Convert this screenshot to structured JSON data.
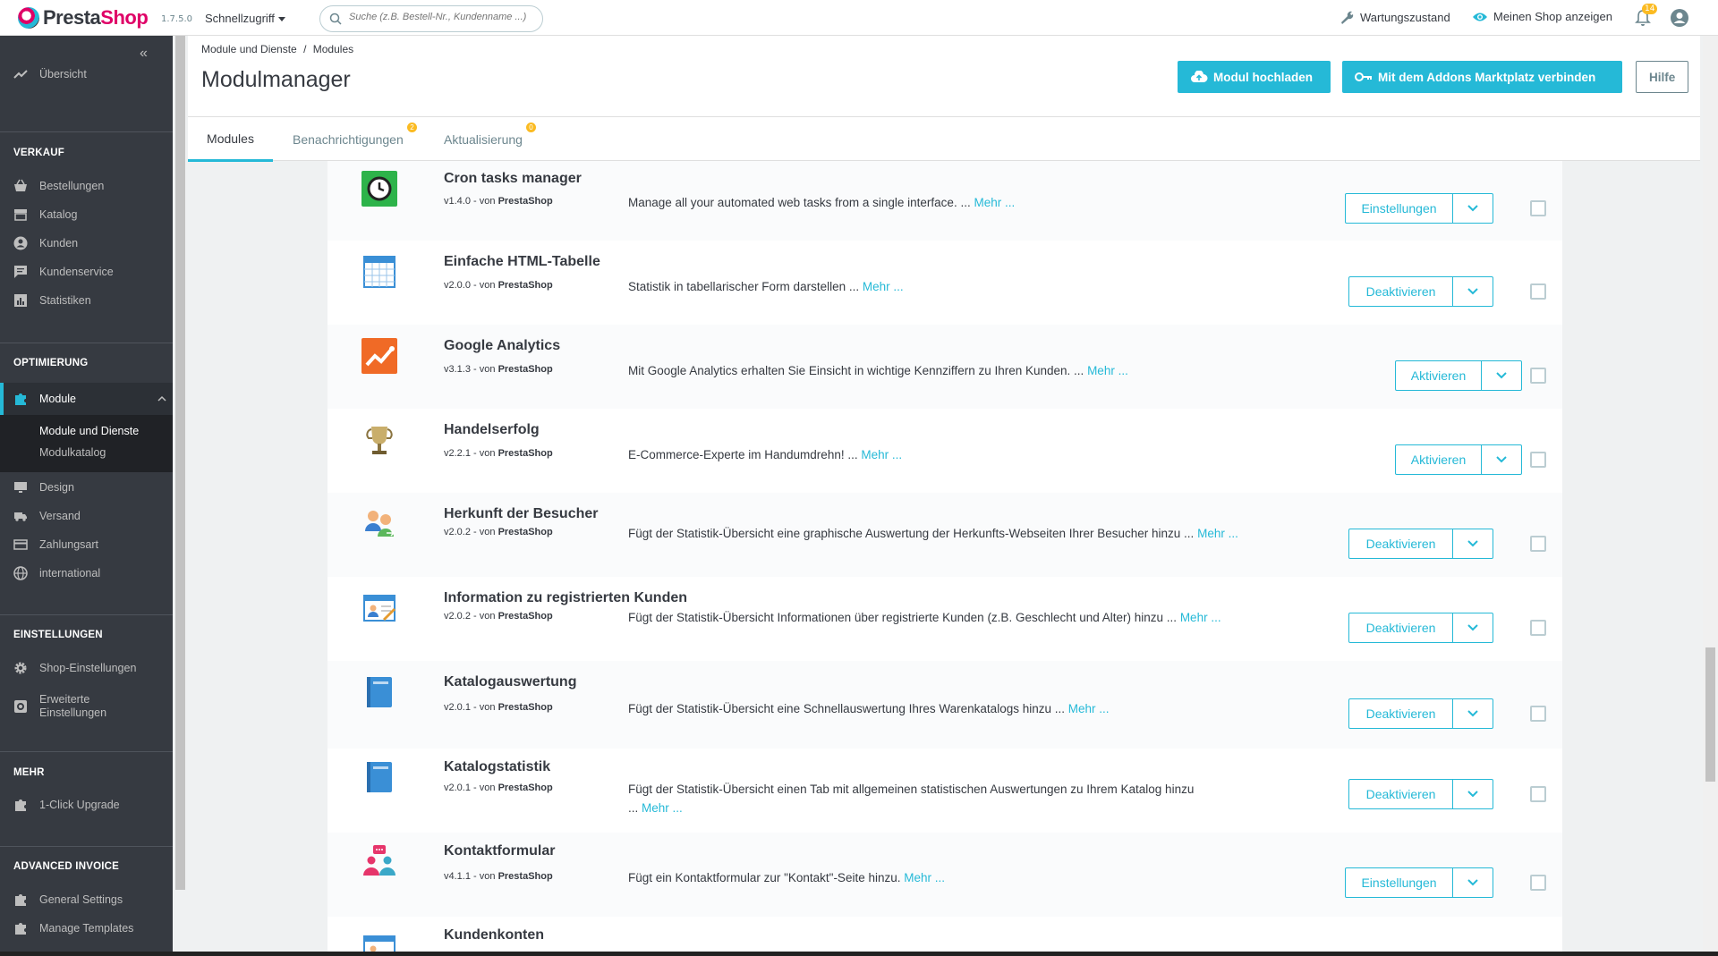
{
  "app": {
    "logo_text_1": "Presta",
    "logo_text_2": "Shop",
    "version": "1.7.5.0",
    "quick_access": "Schnellzugriff",
    "search_placeholder": "Suche (z.B. Bestell-Nr., Kundenname ...)",
    "maintenance": "Wartungszustand",
    "view_shop": "Meinen Shop anzeigen",
    "notifications_count": "14"
  },
  "sidebar": {
    "overview": "Übersicht",
    "sections": [
      {
        "title": "VERKAUF",
        "items": [
          "Bestellungen",
          "Katalog",
          "Kunden",
          "Kundenservice",
          "Statistiken"
        ]
      },
      {
        "title": "OPTIMIERUNG",
        "items": [
          "Module",
          "Design",
          "Versand",
          "Zahlungsart",
          "international"
        ]
      },
      {
        "title": "EINSTELLUNGEN",
        "items": [
          "Shop-Einstellungen",
          "Erweiterte Einstellungen"
        ]
      },
      {
        "title": "MEHR",
        "items": [
          "1-Click Upgrade"
        ]
      },
      {
        "title": "ADVANCED INVOICE",
        "items": [
          "General Settings",
          "Manage Templates"
        ]
      }
    ],
    "module_sub": [
      "Module und Dienste",
      "Modulkatalog"
    ],
    "advanced_line1": "Erweiterte",
    "advanced_line2": "Einstellungen"
  },
  "header": {
    "breadcrumb_1": "Module und Dienste",
    "breadcrumb_sep": "/",
    "breadcrumb_2": "Modules",
    "title": "Modulmanager",
    "upload_button": "Modul hochladen",
    "connect_button": "Mit dem Addons Marktplatz verbinden",
    "help_button": "Hilfe",
    "tabs": [
      {
        "label": "Modules",
        "badge": ""
      },
      {
        "label": "Benachrichtigungen",
        "badge": "2"
      },
      {
        "label": "Aktualisierung",
        "badge": "0"
      }
    ]
  },
  "modules": [
    {
      "name": "Cron tasks manager",
      "version": "v1.4.0",
      "by": "von",
      "author": "PrestaShop",
      "desc": "Manage all your automated web tasks from a single interface. ...",
      "desc2": "",
      "more": "Mehr ...",
      "action": "Einstellungen",
      "icon": "clock-icon",
      "color": "#2db34a"
    },
    {
      "name": "Einfache HTML-Tabelle",
      "version": "v2.0.0",
      "by": "von",
      "author": "PrestaShop",
      "desc": "Statistik in tabellarischer Form darstellen ...",
      "desc2": "",
      "more": "Mehr ...",
      "action": "Deaktivieren",
      "icon": "table-icon",
      "color": "#3a8fd6"
    },
    {
      "name": "Google Analytics",
      "version": "v3.1.3",
      "by": "von",
      "author": "PrestaShop",
      "desc": "Mit Google Analytics erhalten Sie Einsicht in wichtige Kennziffern zu Ihren Kunden. ...",
      "desc2": "",
      "more": "Mehr ...",
      "action": "Aktivieren",
      "icon": "analytics-icon",
      "color": "#f06a26"
    },
    {
      "name": "Handelserfolg",
      "version": "v2.2.1",
      "by": "von",
      "author": "PrestaShop",
      "desc": "E-Commerce-Experte im Handumdrehn! ...",
      "desc2": "",
      "more": "Mehr ...",
      "action": "Aktivieren",
      "icon": "trophy-icon",
      "color": "#b59a5a"
    },
    {
      "name": "Herkunft der Besucher",
      "version": "v2.0.2",
      "by": "von",
      "author": "PrestaShop",
      "desc": "Fügt der Statistik-Übersicht eine graphische Auswertung der Herkunfts-Webseiten Ihrer Besucher hinzu ...",
      "desc2": "",
      "more": "Mehr ...",
      "action": "Deaktivieren",
      "icon": "visitors-icon",
      "color": "#e69b2f"
    },
    {
      "name": "Information zu registrierten Kunden",
      "version": "v2.0.2",
      "by": "von",
      "author": "PrestaShop",
      "desc": "Fügt der Statistik-Übersicht Informationen über registrierte Kunden (z.B. Geschlecht und Alter) hinzu ...",
      "desc2": "",
      "more": "Mehr ...",
      "action": "Deaktivieren",
      "icon": "customer-card-icon",
      "color": "#3a8fd6"
    },
    {
      "name": "Katalogauswertung",
      "version": "v2.0.1",
      "by": "von",
      "author": "PrestaShop",
      "desc": "Fügt der Statistik-Übersicht eine Schnellauswertung Ihres Warenkatalogs hinzu ...",
      "desc2": "",
      "more": "Mehr ...",
      "action": "Deaktivieren",
      "icon": "book-icon",
      "color": "#3a8fd6"
    },
    {
      "name": "Katalogstatistik",
      "version": "v2.0.1",
      "by": "von",
      "author": "PrestaShop",
      "desc": "Fügt der Statistik-Übersicht einen Tab mit allgemeinen statistischen Auswertungen zu Ihrem Katalog hinzu",
      "desc2": "...",
      "more": "Mehr ...",
      "action": "Deaktivieren",
      "icon": "book-icon",
      "color": "#3a8fd6"
    },
    {
      "name": "Kontaktformular",
      "version": "v4.1.1",
      "by": "von",
      "author": "PrestaShop",
      "desc": "Fügt ein Kontaktformular zur \"Kontakt\"-Seite hinzu.",
      "desc2": "",
      "more": "Mehr ...",
      "action": "Einstellungen",
      "icon": "contact-icon",
      "color": "#e6356b"
    },
    {
      "name": "Kundenkonten",
      "version": "",
      "by": "",
      "author": "",
      "desc": "",
      "desc2": "",
      "more": "",
      "action": "",
      "icon": "account-card-icon",
      "color": "#3a8fd6"
    }
  ],
  "colors": {
    "accent": "#25b9d7",
    "sidebar": "#363a41",
    "badge": "#fbbb22"
  }
}
